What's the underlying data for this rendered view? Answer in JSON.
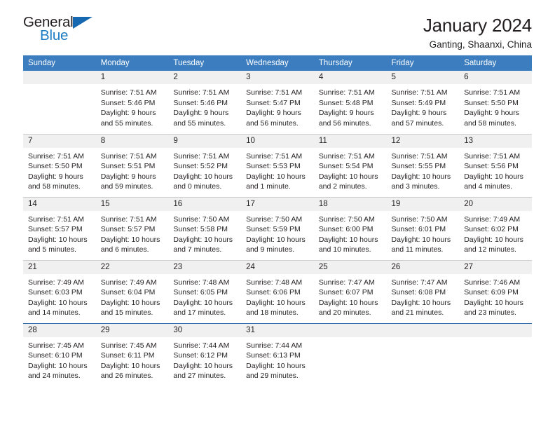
{
  "brand": {
    "name_part1": "General",
    "name_part2": "Blue",
    "triangle_color": "#1668b0",
    "blue_color": "#1d7cc4"
  },
  "header": {
    "title": "January 2024",
    "subtitle": "Ganting, Shaanxi, China",
    "header_bg": "#3b7dbf"
  },
  "weekdays": [
    "Sunday",
    "Monday",
    "Tuesday",
    "Wednesday",
    "Thursday",
    "Friday",
    "Saturday"
  ],
  "labels": {
    "sunrise_prefix": "Sunrise:",
    "sunset_prefix": "Sunset:",
    "daylight_prefix": "Daylight:"
  },
  "weeks": [
    [
      {
        "day": "",
        "sunrise": "",
        "sunset": "",
        "daylight_line1": "",
        "daylight_line2": ""
      },
      {
        "day": "1",
        "sunrise": "Sunrise: 7:51 AM",
        "sunset": "Sunset: 5:46 PM",
        "daylight_line1": "Daylight: 9 hours",
        "daylight_line2": "and 55 minutes."
      },
      {
        "day": "2",
        "sunrise": "Sunrise: 7:51 AM",
        "sunset": "Sunset: 5:46 PM",
        "daylight_line1": "Daylight: 9 hours",
        "daylight_line2": "and 55 minutes."
      },
      {
        "day": "3",
        "sunrise": "Sunrise: 7:51 AM",
        "sunset": "Sunset: 5:47 PM",
        "daylight_line1": "Daylight: 9 hours",
        "daylight_line2": "and 56 minutes."
      },
      {
        "day": "4",
        "sunrise": "Sunrise: 7:51 AM",
        "sunset": "Sunset: 5:48 PM",
        "daylight_line1": "Daylight: 9 hours",
        "daylight_line2": "and 56 minutes."
      },
      {
        "day": "5",
        "sunrise": "Sunrise: 7:51 AM",
        "sunset": "Sunset: 5:49 PM",
        "daylight_line1": "Daylight: 9 hours",
        "daylight_line2": "and 57 minutes."
      },
      {
        "day": "6",
        "sunrise": "Sunrise: 7:51 AM",
        "sunset": "Sunset: 5:50 PM",
        "daylight_line1": "Daylight: 9 hours",
        "daylight_line2": "and 58 minutes."
      }
    ],
    [
      {
        "day": "7",
        "sunrise": "Sunrise: 7:51 AM",
        "sunset": "Sunset: 5:50 PM",
        "daylight_line1": "Daylight: 9 hours",
        "daylight_line2": "and 58 minutes."
      },
      {
        "day": "8",
        "sunrise": "Sunrise: 7:51 AM",
        "sunset": "Sunset: 5:51 PM",
        "daylight_line1": "Daylight: 9 hours",
        "daylight_line2": "and 59 minutes."
      },
      {
        "day": "9",
        "sunrise": "Sunrise: 7:51 AM",
        "sunset": "Sunset: 5:52 PM",
        "daylight_line1": "Daylight: 10 hours",
        "daylight_line2": "and 0 minutes."
      },
      {
        "day": "10",
        "sunrise": "Sunrise: 7:51 AM",
        "sunset": "Sunset: 5:53 PM",
        "daylight_line1": "Daylight: 10 hours",
        "daylight_line2": "and 1 minute."
      },
      {
        "day": "11",
        "sunrise": "Sunrise: 7:51 AM",
        "sunset": "Sunset: 5:54 PM",
        "daylight_line1": "Daylight: 10 hours",
        "daylight_line2": "and 2 minutes."
      },
      {
        "day": "12",
        "sunrise": "Sunrise: 7:51 AM",
        "sunset": "Sunset: 5:55 PM",
        "daylight_line1": "Daylight: 10 hours",
        "daylight_line2": "and 3 minutes."
      },
      {
        "day": "13",
        "sunrise": "Sunrise: 7:51 AM",
        "sunset": "Sunset: 5:56 PM",
        "daylight_line1": "Daylight: 10 hours",
        "daylight_line2": "and 4 minutes."
      }
    ],
    [
      {
        "day": "14",
        "sunrise": "Sunrise: 7:51 AM",
        "sunset": "Sunset: 5:57 PM",
        "daylight_line1": "Daylight: 10 hours",
        "daylight_line2": "and 5 minutes."
      },
      {
        "day": "15",
        "sunrise": "Sunrise: 7:51 AM",
        "sunset": "Sunset: 5:57 PM",
        "daylight_line1": "Daylight: 10 hours",
        "daylight_line2": "and 6 minutes."
      },
      {
        "day": "16",
        "sunrise": "Sunrise: 7:50 AM",
        "sunset": "Sunset: 5:58 PM",
        "daylight_line1": "Daylight: 10 hours",
        "daylight_line2": "and 7 minutes."
      },
      {
        "day": "17",
        "sunrise": "Sunrise: 7:50 AM",
        "sunset": "Sunset: 5:59 PM",
        "daylight_line1": "Daylight: 10 hours",
        "daylight_line2": "and 9 minutes."
      },
      {
        "day": "18",
        "sunrise": "Sunrise: 7:50 AM",
        "sunset": "Sunset: 6:00 PM",
        "daylight_line1": "Daylight: 10 hours",
        "daylight_line2": "and 10 minutes."
      },
      {
        "day": "19",
        "sunrise": "Sunrise: 7:50 AM",
        "sunset": "Sunset: 6:01 PM",
        "daylight_line1": "Daylight: 10 hours",
        "daylight_line2": "and 11 minutes."
      },
      {
        "day": "20",
        "sunrise": "Sunrise: 7:49 AM",
        "sunset": "Sunset: 6:02 PM",
        "daylight_line1": "Daylight: 10 hours",
        "daylight_line2": "and 12 minutes."
      }
    ],
    [
      {
        "day": "21",
        "sunrise": "Sunrise: 7:49 AM",
        "sunset": "Sunset: 6:03 PM",
        "daylight_line1": "Daylight: 10 hours",
        "daylight_line2": "and 14 minutes."
      },
      {
        "day": "22",
        "sunrise": "Sunrise: 7:49 AM",
        "sunset": "Sunset: 6:04 PM",
        "daylight_line1": "Daylight: 10 hours",
        "daylight_line2": "and 15 minutes."
      },
      {
        "day": "23",
        "sunrise": "Sunrise: 7:48 AM",
        "sunset": "Sunset: 6:05 PM",
        "daylight_line1": "Daylight: 10 hours",
        "daylight_line2": "and 17 minutes."
      },
      {
        "day": "24",
        "sunrise": "Sunrise: 7:48 AM",
        "sunset": "Sunset: 6:06 PM",
        "daylight_line1": "Daylight: 10 hours",
        "daylight_line2": "and 18 minutes."
      },
      {
        "day": "25",
        "sunrise": "Sunrise: 7:47 AM",
        "sunset": "Sunset: 6:07 PM",
        "daylight_line1": "Daylight: 10 hours",
        "daylight_line2": "and 20 minutes."
      },
      {
        "day": "26",
        "sunrise": "Sunrise: 7:47 AM",
        "sunset": "Sunset: 6:08 PM",
        "daylight_line1": "Daylight: 10 hours",
        "daylight_line2": "and 21 minutes."
      },
      {
        "day": "27",
        "sunrise": "Sunrise: 7:46 AM",
        "sunset": "Sunset: 6:09 PM",
        "daylight_line1": "Daylight: 10 hours",
        "daylight_line2": "and 23 minutes."
      }
    ],
    [
      {
        "day": "28",
        "sunrise": "Sunrise: 7:45 AM",
        "sunset": "Sunset: 6:10 PM",
        "daylight_line1": "Daylight: 10 hours",
        "daylight_line2": "and 24 minutes."
      },
      {
        "day": "29",
        "sunrise": "Sunrise: 7:45 AM",
        "sunset": "Sunset: 6:11 PM",
        "daylight_line1": "Daylight: 10 hours",
        "daylight_line2": "and 26 minutes."
      },
      {
        "day": "30",
        "sunrise": "Sunrise: 7:44 AM",
        "sunset": "Sunset: 6:12 PM",
        "daylight_line1": "Daylight: 10 hours",
        "daylight_line2": "and 27 minutes."
      },
      {
        "day": "31",
        "sunrise": "Sunrise: 7:44 AM",
        "sunset": "Sunset: 6:13 PM",
        "daylight_line1": "Daylight: 10 hours",
        "daylight_line2": "and 29 minutes."
      },
      {
        "day": "",
        "sunrise": "",
        "sunset": "",
        "daylight_line1": "",
        "daylight_line2": ""
      },
      {
        "day": "",
        "sunrise": "",
        "sunset": "",
        "daylight_line1": "",
        "daylight_line2": ""
      },
      {
        "day": "",
        "sunrise": "",
        "sunset": "",
        "daylight_line1": "",
        "daylight_line2": ""
      }
    ]
  ]
}
